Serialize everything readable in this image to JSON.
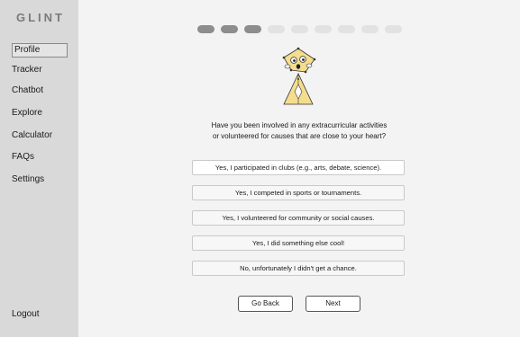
{
  "brand": "GLINT",
  "sidebar": {
    "items": [
      {
        "label": "Profile"
      },
      {
        "label": "Tracker"
      },
      {
        "label": "Chatbot"
      },
      {
        "label": "Explore"
      },
      {
        "label": "Calculator"
      },
      {
        "label": "FAQs"
      },
      {
        "label": "Settings"
      }
    ],
    "logout": "Logout"
  },
  "progress": {
    "completed_steps": 3,
    "total_steps": 9
  },
  "colors": {
    "sidebar": "#d9d9d9",
    "main": "#f3f3f3",
    "step_done": "#8d8d8d",
    "step_todo": "#e2e2e2",
    "mascot": "#f5dd8e"
  },
  "question": {
    "line1": "Have you been involved in any extracurricular activities",
    "line2": "or volunteered for causes that are close to your heart?"
  },
  "options": [
    "Yes, I participated in clubs (e.g., arts, debate, science).",
    "Yes, I competed in sports or tournaments.",
    "Yes, I volunteered for community or social causes.",
    "Yes, I did something else cool!",
    "No, unfortunately I didn't get a chance."
  ],
  "buttons": {
    "back": "Go Back",
    "next": "Next"
  }
}
